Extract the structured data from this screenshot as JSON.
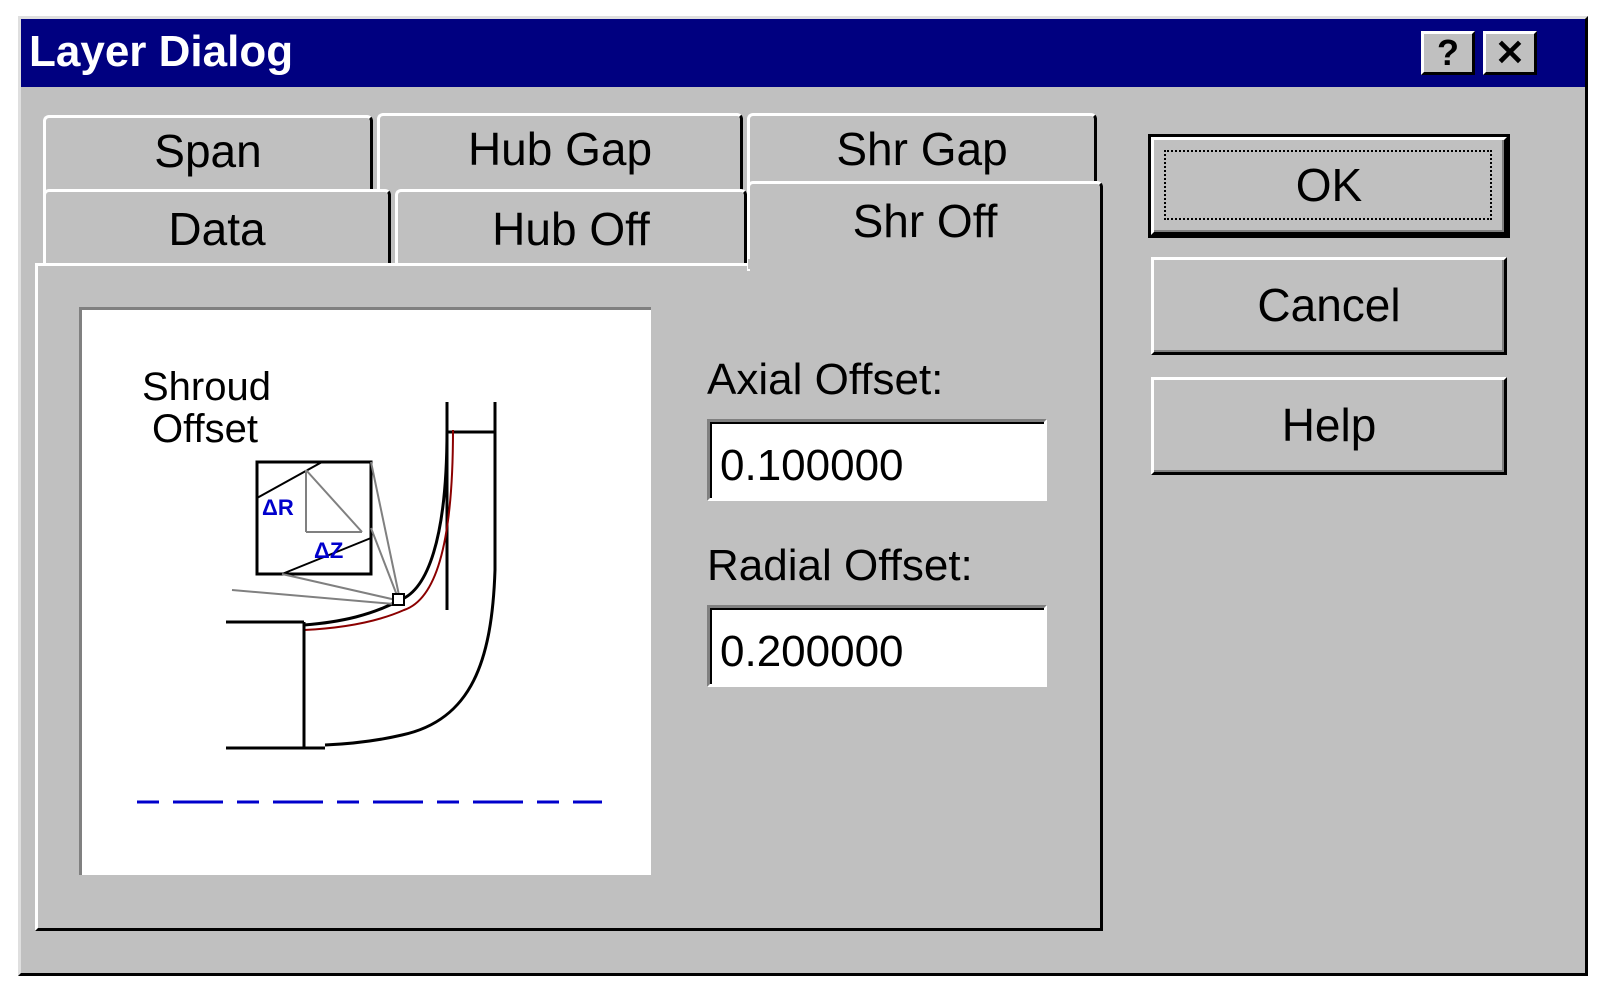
{
  "window": {
    "title": "Layer Dialog",
    "help_button": "?",
    "close_button": "✕"
  },
  "tabs": {
    "row_back": [
      {
        "label": "Span"
      },
      {
        "label": "Hub Gap"
      },
      {
        "label": "Shr Gap"
      }
    ],
    "row_front": [
      {
        "label": "Data"
      },
      {
        "label": "Hub Off"
      },
      {
        "label": "Shr Off"
      }
    ],
    "active": "Shr Off"
  },
  "figure": {
    "label_line1": "Shroud",
    "label_line2": "Offset",
    "delta_r": "ΔR",
    "delta_z": "ΔZ"
  },
  "fields": {
    "axial_label": "Axial Offset:",
    "axial_value": "0.100000",
    "radial_label": "Radial Offset:",
    "radial_value": "0.200000"
  },
  "buttons": {
    "ok": "OK",
    "cancel": "Cancel",
    "help": "Help"
  },
  "colors": {
    "titlebar": "#000080",
    "face": "#c0c0c0",
    "centerline": "#0000cc"
  }
}
